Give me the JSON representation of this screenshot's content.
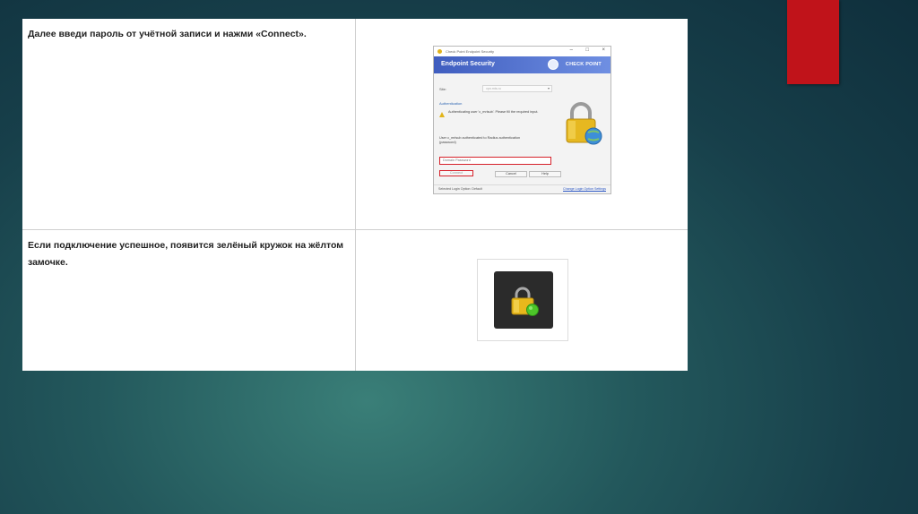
{
  "slide": {
    "colors": {
      "accent": "#c0131a",
      "background": "#1d4a54",
      "table_bg": "#ffffff"
    }
  },
  "rows": [
    {
      "instruction": "Далее введи пароль от учётной записи и нажми «Connect»."
    },
    {
      "instruction": "Если подключение успешное, появится зелёный кружок на жёлтом замочке."
    }
  ],
  "dialog": {
    "window_title": "Check Point Endpoint Security",
    "product_name": "Endpoint Security",
    "brand": "CHECK POINT",
    "site_label": "Site:",
    "site_value": "vpn.mts.ru",
    "auth_heading": "Authentication",
    "auth_message": "Authenticating user 'c_mrlsub'. Please fill the required input.",
    "user_message": "User c_mrlsub authenticated to Radius authentication (password)",
    "password_placeholder": "Domain Password",
    "connect_label": "Connect",
    "cancel_label": "Cancel",
    "help_label": "Help",
    "status_left": "Selected Login Option: Default",
    "status_right": "Change Login Option Settings"
  }
}
